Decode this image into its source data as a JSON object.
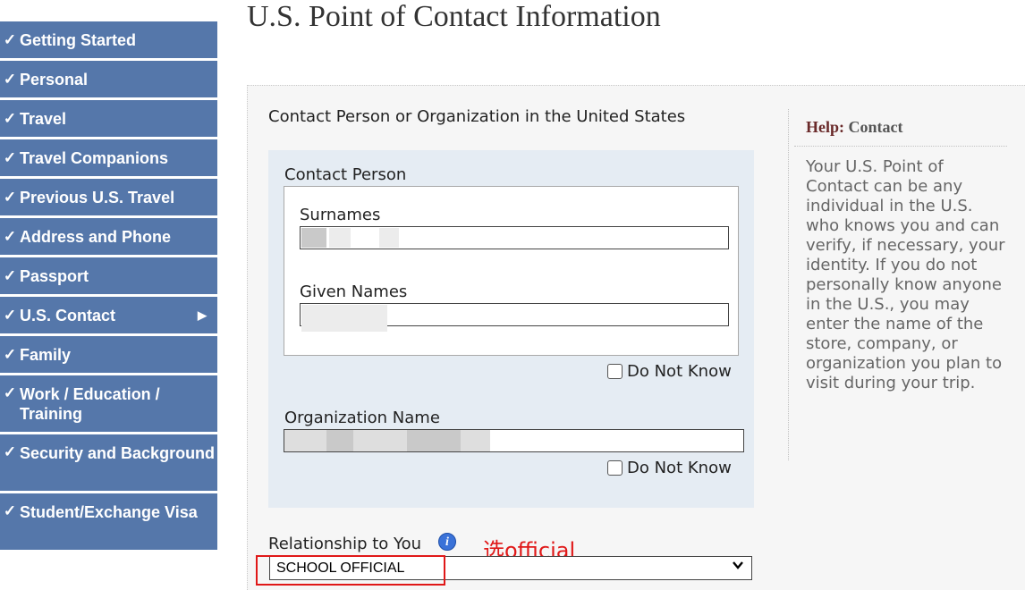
{
  "sidebar": {
    "items": [
      {
        "label": "Getting Started",
        "check": "✓"
      },
      {
        "label": "Personal",
        "check": "✓"
      },
      {
        "label": "Travel",
        "check": "✓"
      },
      {
        "label": "Travel Companions",
        "check": "✓"
      },
      {
        "label": "Previous U.S. Travel",
        "check": "✓"
      },
      {
        "label": "Address and Phone",
        "check": "✓"
      },
      {
        "label": "Passport",
        "check": "✓"
      },
      {
        "label": "U.S. Contact",
        "check": "✓",
        "arrow": "▶"
      },
      {
        "label": "Family",
        "check": "✓"
      },
      {
        "label": "Work / Education / Training",
        "check": "✓"
      },
      {
        "label": "Security and Background",
        "check": "✓"
      },
      {
        "label": "Student/Exchange Visa",
        "check": "✓"
      }
    ]
  },
  "page": {
    "title": "U.S. Point of Contact Information"
  },
  "form": {
    "section_label": "Contact Person or Organization in the United States",
    "contact_person_label": "Contact Person",
    "surnames_label": "Surnames",
    "given_names_label": "Given Names",
    "do_not_know_label": "Do Not Know",
    "organization_label": "Organization Name",
    "relationship_label": "Relationship to You",
    "relationship_value": "SCHOOL OFFICIAL",
    "info_icon_glyph": "i"
  },
  "annotation": {
    "text": "选official",
    "color": "#e01818"
  },
  "help": {
    "title_prefix": "Help:",
    "title_topic": "Contact",
    "text": "Your U.S. Point of Contact can be any individual in the U.S. who knows you and can verify, if necessary, your identity. If you do not personally know anyone in the U.S., you may enter the name of the store, company, or organization you plan to visit during your trip."
  },
  "colors": {
    "sidebar": "#5577aa",
    "panel": "#f6f6f6",
    "contact_box": "#e5ecf3"
  }
}
